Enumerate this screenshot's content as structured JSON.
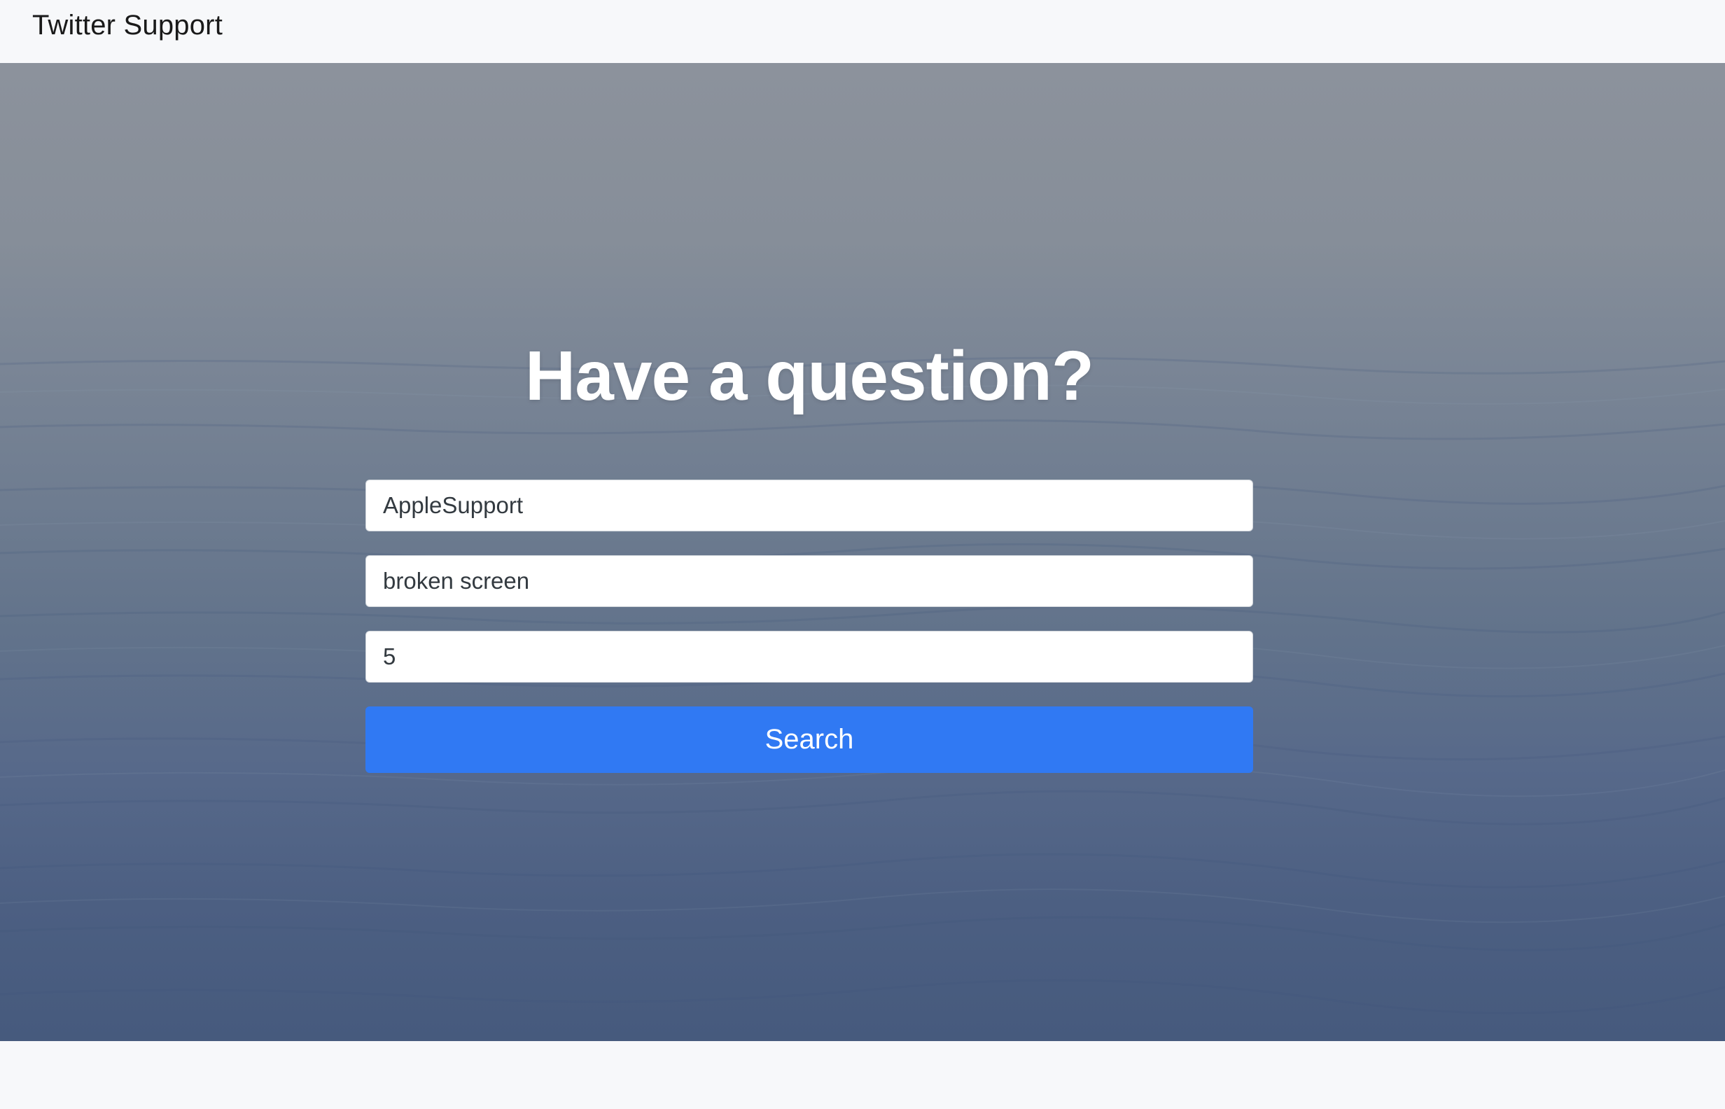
{
  "navbar": {
    "brand": "Twitter Support"
  },
  "hero": {
    "headline": "Have a question?",
    "fields": [
      {
        "value": "AppleSupport"
      },
      {
        "value": "broken screen"
      },
      {
        "value": "5"
      }
    ],
    "search_label": "Search"
  },
  "colors": {
    "primary_button": "#3079f3",
    "navbar_bg": "#f7f8fa",
    "headline_text": "#ffffff"
  }
}
